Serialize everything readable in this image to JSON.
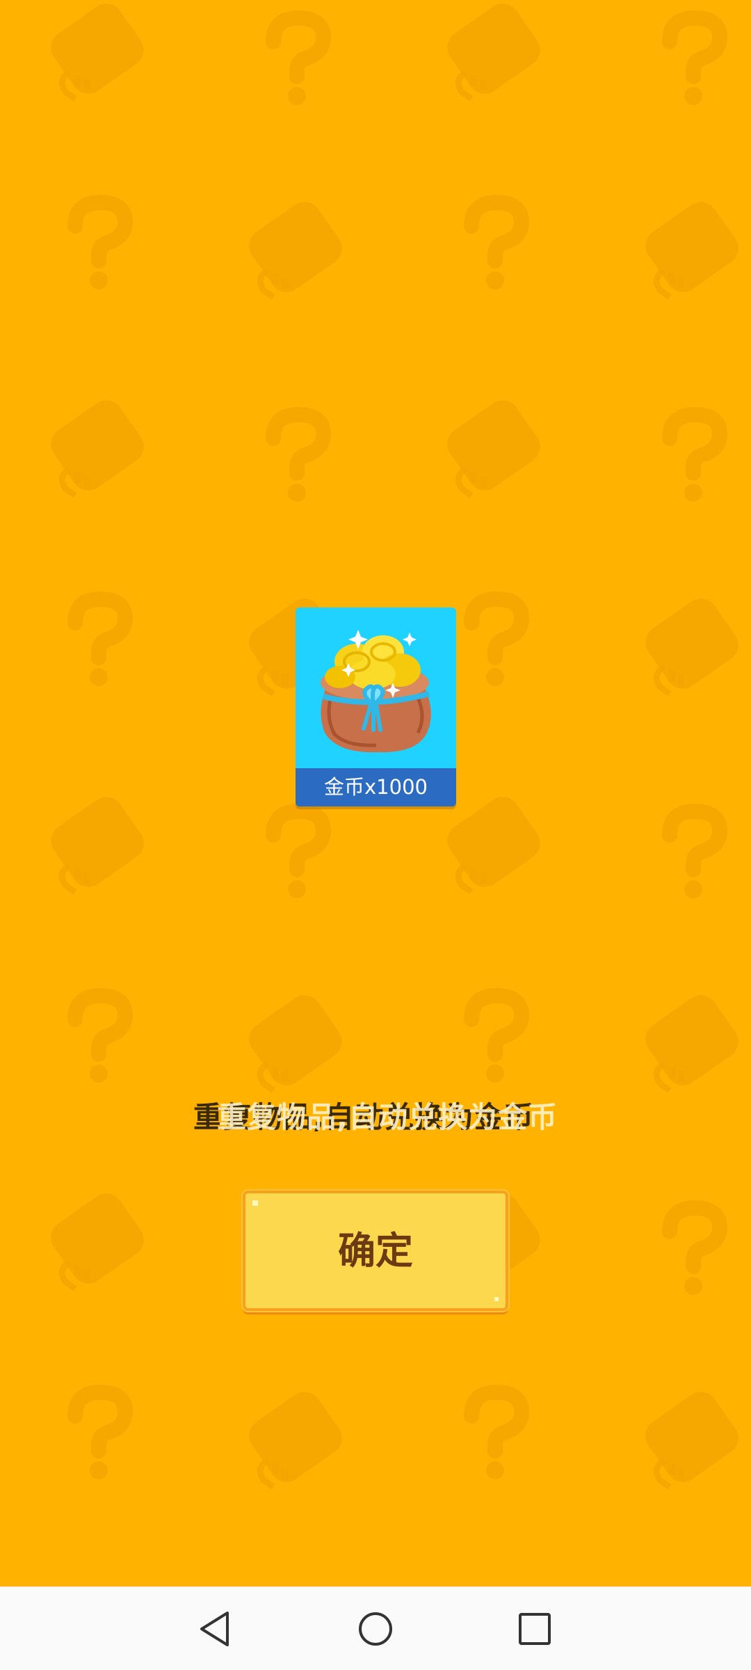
{
  "reward": {
    "caption": "金币x1000",
    "icon": "coin-bag-icon"
  },
  "message": {
    "text_back": "重复物品,自动兑换为金币",
    "text_front": "重复物品,自动兑换为金币"
  },
  "confirm_button": {
    "label": "确定"
  },
  "nav_bar": {
    "back_icon": "back-triangle-icon",
    "home_icon": "home-circle-icon",
    "recents_icon": "recents-square-icon"
  },
  "colors": {
    "background": "#FFB300",
    "card": "#1FD2FF",
    "caption_bar": "#2B6BC2",
    "button_fill": "#FCD84F",
    "button_border": "#F7A21A",
    "button_text": "#6B3A12"
  }
}
